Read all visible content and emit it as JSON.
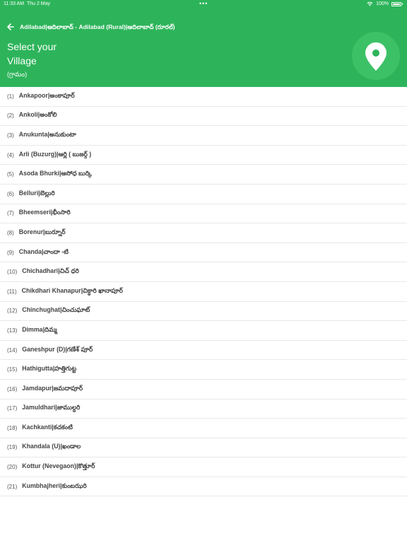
{
  "status_bar": {
    "time": "11:33 AM",
    "date": "Thu 2 May",
    "battery": "100%",
    "icons": [
      "wifi-icon",
      "battery-icon"
    ]
  },
  "header": {
    "breadcrumb": "Adilabad|ఆదిలాబాద్ - Adilabad (Rural)|ఆదిలాబాద్ (రూరల్)",
    "title": "Select your Village",
    "subtitle": "(గ్రామం)",
    "back_icon": "arrow-left-icon",
    "pin_icon": "location-pin-icon"
  },
  "colors": {
    "header_bg": "#2db45a",
    "pin_circle": "#3cc166"
  },
  "villages": [
    {
      "num": "(1)",
      "name": "Ankapoor|అంకాపూర్"
    },
    {
      "num": "(2)",
      "name": "Ankoli|అంకోలి"
    },
    {
      "num": "(3)",
      "name": "Anukunta|అనుకుంటా"
    },
    {
      "num": "(4)",
      "name": "Arli (Buzurg)|ఆర్లి ( బుజర్గ్ )"
    },
    {
      "num": "(5)",
      "name": "Asoda Bhurki|ఆసోధ బుర్కి"
    },
    {
      "num": "(6)",
      "name": "Belluri|బెల్లురి"
    },
    {
      "num": "(7)",
      "name": "Bheemseri|భీంసారి"
    },
    {
      "num": "(8)",
      "name": "Borenur|బుర్నూర్"
    },
    {
      "num": "(9)",
      "name": "Chanda|చాందా -టి"
    },
    {
      "num": "(10)",
      "name": "Chichadhari|చిచ్ ధరి"
    },
    {
      "num": "(11)",
      "name": "Chikdhari Khanapur|చిక్ధారి ఖానాపూర్"
    },
    {
      "num": "(12)",
      "name": "Chinchughat|చించుఘాట్"
    },
    {
      "num": "(13)",
      "name": "Dimma|దిమ్మ"
    },
    {
      "num": "(14)",
      "name": "Ganeshpur (D)|గణేశ్ పూర్"
    },
    {
      "num": "(15)",
      "name": "Hathigutta|హత్తిగుట్ట"
    },
    {
      "num": "(16)",
      "name": "Jamdapur|జమదాపూర్"
    },
    {
      "num": "(17)",
      "name": "Jamuldhari|జాముల్ధరి"
    },
    {
      "num": "(18)",
      "name": "Kachkanti|కచకంటి"
    },
    {
      "num": "(19)",
      "name": "Khandala (U)|ఖండాల"
    },
    {
      "num": "(20)",
      "name": "Kottur (Nevegaon)|కొత్తూర్"
    },
    {
      "num": "(21)",
      "name": "Kumbhajheri|కుంబఝరి"
    }
  ]
}
